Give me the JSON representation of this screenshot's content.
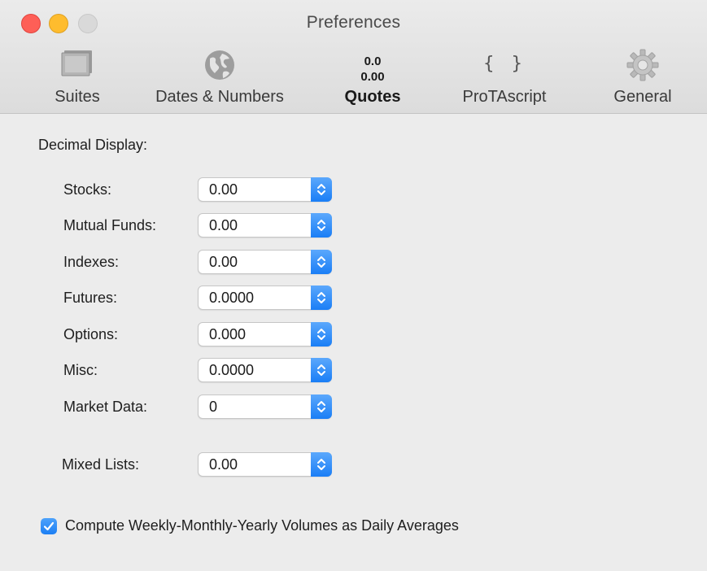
{
  "window": {
    "title": "Preferences"
  },
  "toolbar": {
    "tabs": [
      {
        "label": "Suites",
        "icon": "suites-icon",
        "active": false
      },
      {
        "label": "Dates & Numbers",
        "icon": "globe-icon",
        "active": false
      },
      {
        "label": "Quotes",
        "icon": "quotes-icon",
        "active": true,
        "glyph_line1": "0.0",
        "glyph_line2": "0.00"
      },
      {
        "label": "ProTAscript",
        "icon": "braces-icon",
        "active": false,
        "glyph": "{ }"
      },
      {
        "label": "General",
        "icon": "gear-icon",
        "active": false
      }
    ]
  },
  "content": {
    "section_title": "Decimal Display:",
    "fields": [
      {
        "label": "Stocks:",
        "value": "0.00"
      },
      {
        "label": "Mutual Funds:",
        "value": "0.00"
      },
      {
        "label": "Indexes:",
        "value": "0.00"
      },
      {
        "label": "Futures:",
        "value": "0.0000"
      },
      {
        "label": "Options:",
        "value": "0.000"
      },
      {
        "label": "Misc:",
        "value": "0.0000"
      },
      {
        "label": "Market Data:",
        "value": "0"
      }
    ],
    "mixed_lists": {
      "label": "Mixed Lists:",
      "value": "0.00"
    },
    "checkbox": {
      "label": "Compute Weekly-Monthly-Yearly Volumes as Daily Averages",
      "checked": true
    }
  },
  "colors": {
    "accent": "#1a7ef6",
    "close": "#fe5f57",
    "minimize": "#febc2e",
    "zoom_inactive": "#d9d9d9",
    "background": "#ececec"
  }
}
